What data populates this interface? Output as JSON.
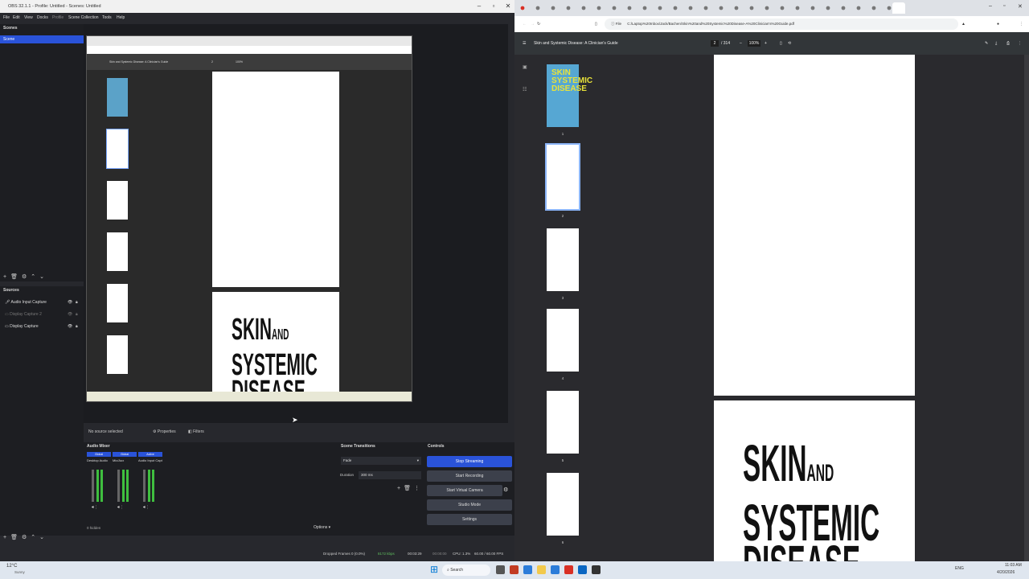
{
  "obs": {
    "title": "OBS 32.1.1 - Profile: Untitled - Scenes: Untitled",
    "menu": [
      "File",
      "Edit",
      "View",
      "Docks",
      "Profile",
      "Scene Collection",
      "Tools",
      "Help"
    ],
    "scenes_title": "Scenes",
    "scenes": [
      "Scene"
    ],
    "sources_title": "Sources",
    "sources": [
      {
        "label": "Audio Input Capture",
        "dim": false
      },
      {
        "label": "Display Capture 2",
        "dim": true
      },
      {
        "label": "Display Capture",
        "dim": false
      }
    ],
    "no_source": "No source selected",
    "properties": "Properties",
    "filters": "Filters",
    "audio_mixer_title": "Audio Mixer",
    "mixer_channels": [
      {
        "name": "Desktop Audio",
        "tag": "Global"
      },
      {
        "name": "Mic/Aux",
        "tag": "Global"
      },
      {
        "name": "Audio Input Capture",
        "tag": "Active"
      }
    ],
    "hidden_count": "0 hidden",
    "options": "Options",
    "transitions_title": "Scene Transitions",
    "transition_value": "Fade",
    "duration_label": "Duration",
    "duration_value": "300 ms",
    "controls_title": "Controls",
    "controls": [
      "Stop Streaming",
      "Start Recording",
      "Start Virtual Camera",
      "Studio Mode",
      "Settings"
    ],
    "status": {
      "dropped": "Dropped Frames 0 (0.0%)",
      "kbps": "8172 kbps",
      "stream_time": "00:03:29",
      "rec_time": "00:00:00",
      "cpu": "CPU: 1.3%",
      "fps": "60.00 / 60.00 FPS"
    },
    "preview": {
      "pdf_title": "Skin and Systemic Disease: A Clinician's Guide",
      "page_num": "2",
      "zoom": "100%",
      "cover_line1": "SKIN",
      "cover_and": "AND",
      "cover_line2": "SYSTEMIC",
      "cover_line3": "DISEASE"
    }
  },
  "chrome": {
    "url": "C:/Laptop%20Inbox/Jack/Bachen/Skin%20and%20Systemic%20Disease-A%20Clinician's%20Guide.pdf",
    "file_label": "File",
    "pdf_title": "Skin and Systemic Disease: A Clinician's Guide",
    "page_current": "2",
    "page_total": "/ 314",
    "zoom": "100%",
    "thumb_numbers": [
      "1",
      "2",
      "3",
      "4",
      "5",
      "6"
    ],
    "cover_line1": "SKIN",
    "cover_and": "AND",
    "cover_line2": "SYSTEMIC",
    "cover_line3": "DISEASE",
    "thumb_cover_line1": "SKIN",
    "thumb_cover_line2": "SYSTEMIC",
    "thumb_cover_line3": "DISEASE"
  },
  "taskbar": {
    "weather_temp": "12°C",
    "weather_desc": "Sunny",
    "search_label": "Search",
    "lang": "ENG",
    "time": "11:03 AM",
    "date": "4/20/2026"
  },
  "colors": {
    "accent_blue": "#2a53d9",
    "obs_panel": "#1d1e22",
    "meter_green": "#3fbf3f"
  }
}
